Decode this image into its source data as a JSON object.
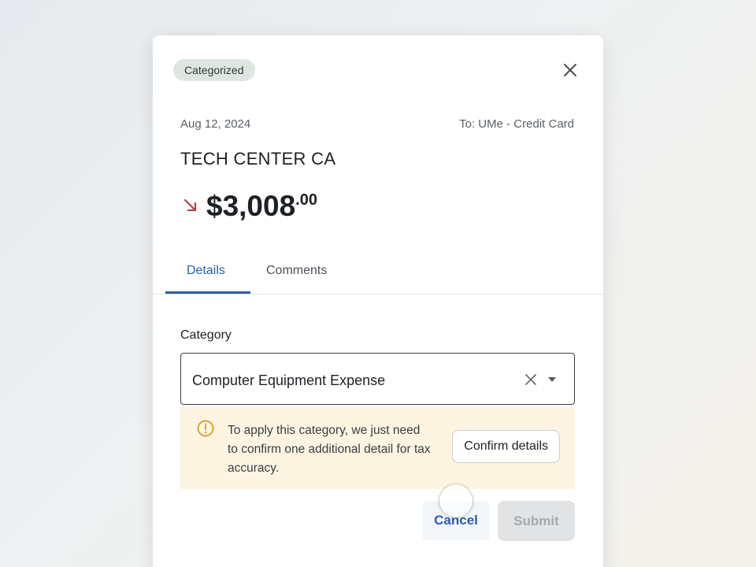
{
  "modal": {
    "badge": "Categorized",
    "close_icon": "close-icon",
    "date": "Aug 12, 2024",
    "to_account": "To: UMe - Credit Card",
    "merchant": "TECH CENTER CA",
    "amount": {
      "main": "$3,008",
      "cents": ".00",
      "direction_icon": "arrow-down-right-icon",
      "direction_color": "#b8404a"
    },
    "tabs": [
      {
        "label": "Details",
        "active": true
      },
      {
        "label": "Comments",
        "active": false
      }
    ],
    "category": {
      "label": "Category",
      "value": "Computer Equipment Expense",
      "clear_icon": "clear-icon",
      "dropdown_icon": "chevron-down-icon"
    },
    "notice": {
      "icon": "warning-icon",
      "text": "To apply this category, we just need to confirm one additional detail for tax accuracy.",
      "button_label": "Confirm details"
    },
    "actions": {
      "cancel_label": "Cancel",
      "submit_label": "Submit"
    }
  },
  "colors": {
    "accent": "#2a5caa",
    "badge_bg": "#dfe6e1",
    "notice_bg": "#fdf5e2",
    "warning": "#d9a531",
    "submit_disabled_bg": "#e2e3e5"
  }
}
